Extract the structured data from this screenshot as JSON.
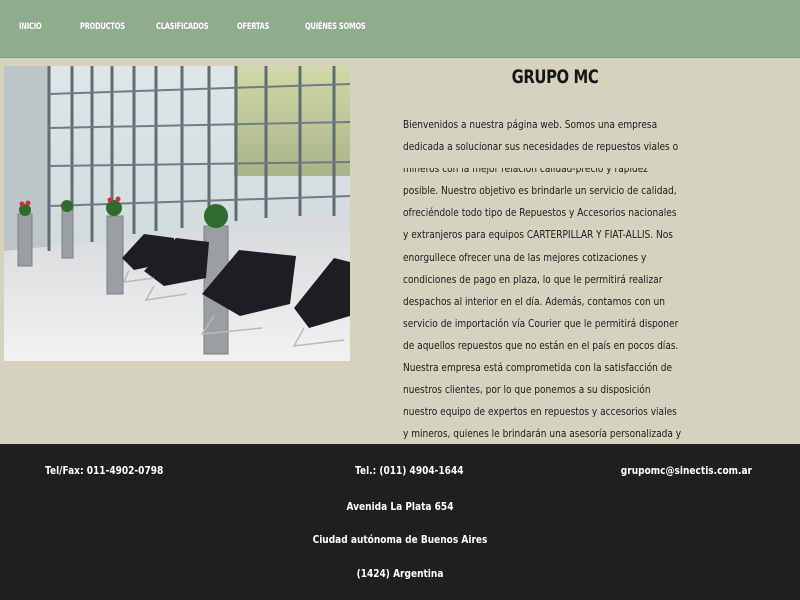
{
  "nav": {
    "items": [
      {
        "label": "INICIO"
      },
      {
        "label": "PRODUCTOS"
      },
      {
        "label": "CLASIFICADOS"
      },
      {
        "label": "OFERTAS"
      },
      {
        "label": "QUIÉNES SOMOS"
      }
    ]
  },
  "main": {
    "title": "GRUPO MC",
    "intro": "Bienvenidos a nuestra página web. Somos una empresa dedicada a solucionar sus necesidades de repuestos viales o mineros con la mejor relación calidad-precio y rapidez posible. Nuestro objetivo es brindarle un servicio de calidad, ofreciéndole todo tipo de Repuestos y Accesorios nacionales y extranjeros para equipos CARTERPILLAR Y FIAT-ALLIS. Nos enorgullece ofrecer una de las mejores cotizaciones y condiciones de pago en plaza, lo que le permitirá realizar despachos al interior en el día. Además, contamos con un servicio de importación vía Courier que le permitirá disponer de aquellos repuestos que no están en el país en pocos días. Nuestra empresa está comprometida con la satisfacción de nuestros clientes, por lo que ponemos a su disposición nuestro equipo de expertos en repuestos y accesorios viales y mineros, quienes le brindarán una asesoría personalizada y profesional en todo momento. Gracias por elegirnos y confiar en nuestros servicios. Estamos seguros de que encontrará en nosotros la solución que necesita para su negocio."
  },
  "footer": {
    "tel_fax": "Tel/Fax: 011-4902-0798",
    "tel": "Tel.: (011) 4904-1644",
    "email": "grupomc@sinectis.com.ar",
    "address": "Avenida La Plata 654",
    "city": "Ciudad autónoma de Buenos Aires",
    "postal": "(1424) Argentina"
  }
}
